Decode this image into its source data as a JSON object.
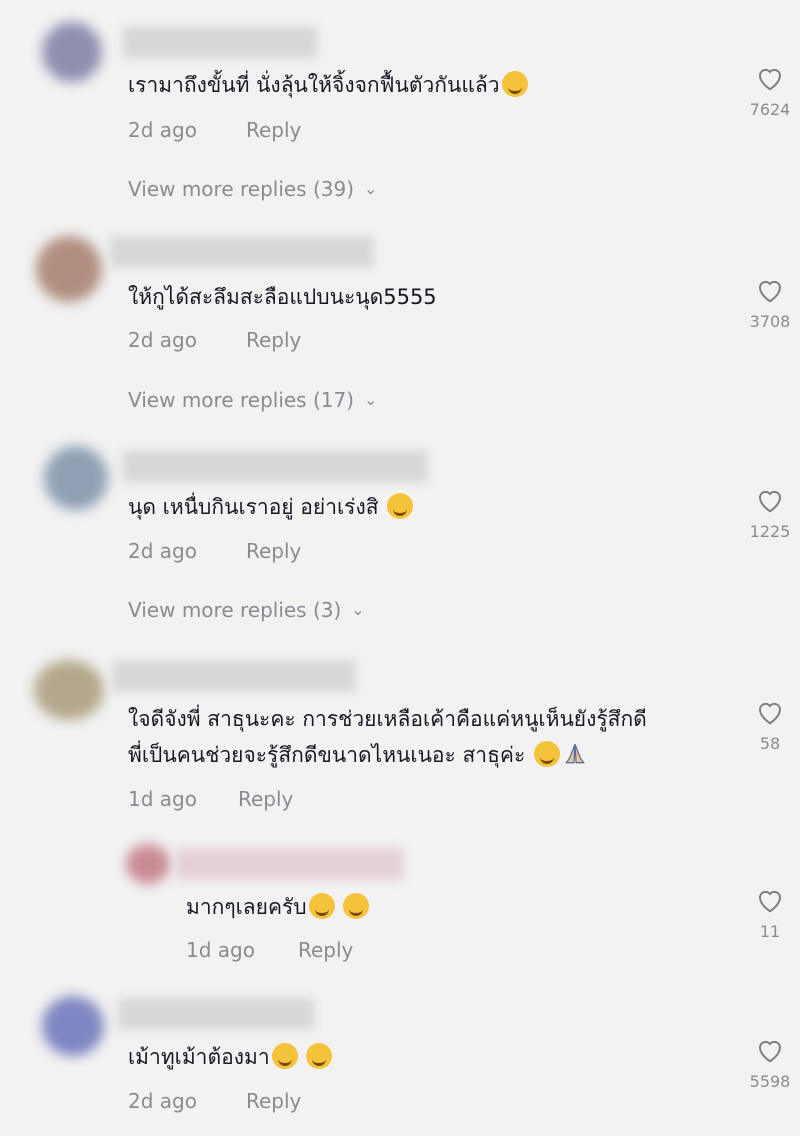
{
  "comments": [
    {
      "text": "เรามาถึงขั้นที่ นั่งลุ้นให้จิ้งจกฟื้นตัวกันแล้ว",
      "time": "2d ago",
      "reply": "Reply",
      "likes": "7624",
      "more": "View more replies (39)"
    },
    {
      "text": "ให้กูได้สะลึมสะลือแปบนะนุด5555",
      "time": "2d ago",
      "reply": "Reply",
      "likes": "3708",
      "more": "View more replies (17)"
    },
    {
      "text": "นุด เหนื่บกินเราอยู่ อย่าเร่งสิ",
      "time": "2d ago",
      "reply": "Reply",
      "likes": "1225",
      "more": "View more replies (3)"
    },
    {
      "text_line1": "ใจดีจังพี่ สาธุนะคะ การช่วยเหลือเค้าคือแค่หนูเห็นยังรู้สึกดี",
      "text_line2": "พี่เป็นคนช่วยจะรู้สึกดีขนาดไหนเนอะ สาธุค่ะ",
      "time": "1d ago",
      "reply": "Reply",
      "likes": "58"
    },
    {
      "text": "มากๆเลยครับ",
      "time": "1d ago",
      "reply": "Reply",
      "likes": "11"
    },
    {
      "text": "เม้าทูเม้าต้องมา",
      "time": "2d ago",
      "reply": "Reply",
      "likes": "5598"
    }
  ],
  "icons": {
    "like": "heart-outline-icon",
    "chevron": "chevron-down-icon",
    "emoji": "laughing-emoji-icon"
  },
  "colors": {
    "text": "#161823",
    "muted": "#8a8b91",
    "background": "#f2f2f2"
  }
}
